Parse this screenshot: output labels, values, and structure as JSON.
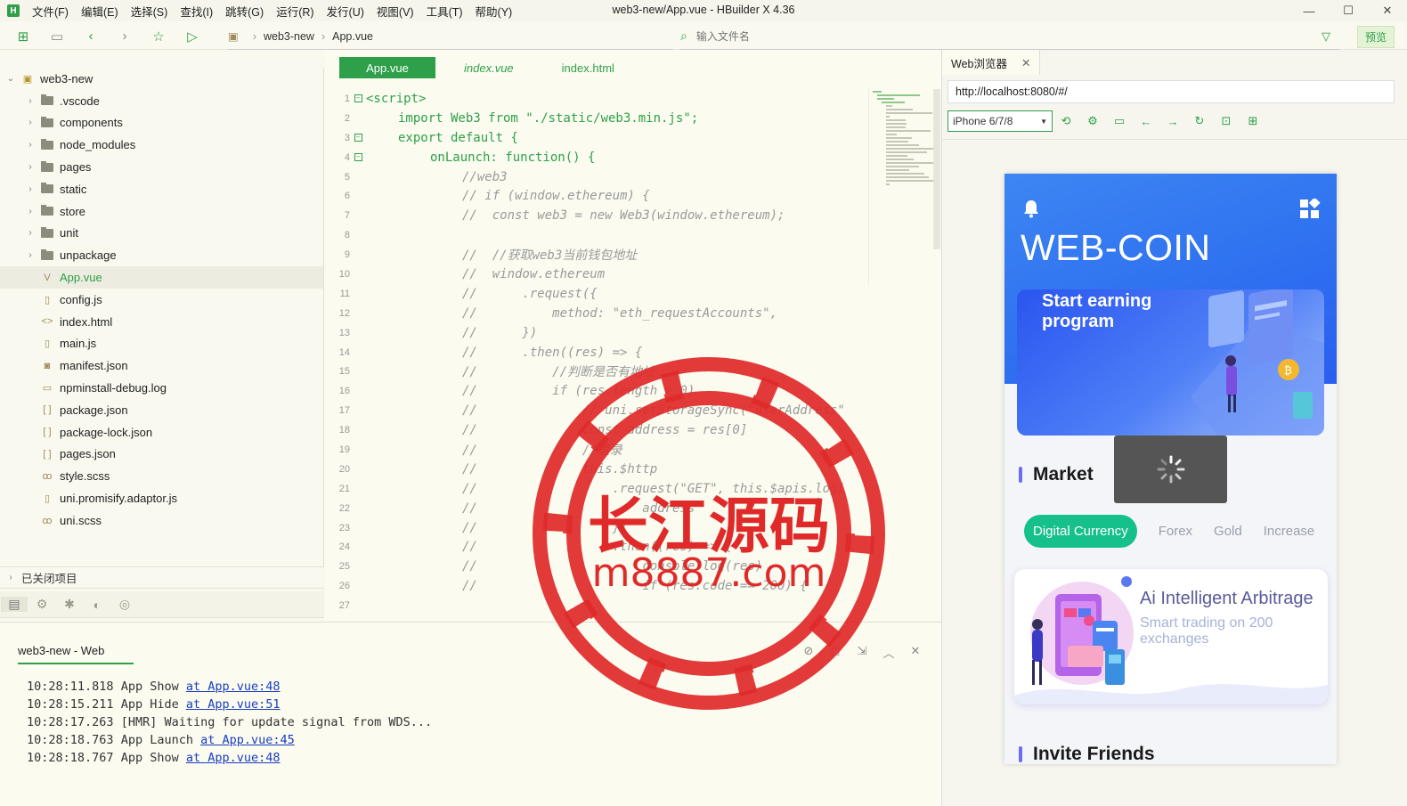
{
  "window": {
    "title": "web3-new/App.vue - HBuilder X 4.36",
    "menu": [
      "文件(F)",
      "编辑(E)",
      "选择(S)",
      "查找(I)",
      "跳转(G)",
      "运行(R)",
      "发行(U)",
      "视图(V)",
      "工具(T)",
      "帮助(Y)"
    ],
    "controls": [
      "—",
      "☐",
      "✕"
    ]
  },
  "toolbar": {
    "breadcrumb": [
      "web3-new",
      "App.vue"
    ],
    "search_placeholder": "输入文件名",
    "preview_label": "预览"
  },
  "sidebar": {
    "project": "web3-new",
    "items": [
      {
        "label": ".vscode",
        "kind": "folder"
      },
      {
        "label": "components",
        "kind": "folder"
      },
      {
        "label": "node_modules",
        "kind": "folder"
      },
      {
        "label": "pages",
        "kind": "folder"
      },
      {
        "label": "static",
        "kind": "folder"
      },
      {
        "label": "store",
        "kind": "folder"
      },
      {
        "label": "unit",
        "kind": "folder"
      },
      {
        "label": "unpackage",
        "kind": "folder"
      },
      {
        "label": "App.vue",
        "kind": "vue",
        "selected": true
      },
      {
        "label": "config.js",
        "kind": "js"
      },
      {
        "label": "index.html",
        "kind": "html"
      },
      {
        "label": "main.js",
        "kind": "js"
      },
      {
        "label": "manifest.json",
        "kind": "manifest"
      },
      {
        "label": "npminstall-debug.log",
        "kind": "log"
      },
      {
        "label": "package.json",
        "kind": "json"
      },
      {
        "label": "package-lock.json",
        "kind": "json"
      },
      {
        "label": "pages.json",
        "kind": "json"
      },
      {
        "label": "style.scss",
        "kind": "scss"
      },
      {
        "label": "uni.promisify.adaptor.js",
        "kind": "js"
      },
      {
        "label": "uni.scss",
        "kind": "scss"
      }
    ],
    "closed_projects": "已关闭项目"
  },
  "editor": {
    "tabs": [
      "App.vue",
      "index.vue",
      "index.html"
    ],
    "lines": [
      {
        "n": "1",
        "fold": "minus",
        "indent": 0,
        "text": "<script>",
        "comment": false
      },
      {
        "n": "2",
        "fold": "",
        "indent": 1,
        "text": "import Web3 from \"./static/web3.min.js\";",
        "comment": false
      },
      {
        "n": "3",
        "fold": "minus",
        "indent": 1,
        "text": "export default {",
        "comment": false
      },
      {
        "n": "4",
        "fold": "minus",
        "indent": 2,
        "text": "onLaunch: function() {",
        "comment": false
      },
      {
        "n": "5",
        "fold": "",
        "indent": 3,
        "text": "//web3",
        "comment": true
      },
      {
        "n": "6",
        "fold": "",
        "indent": 3,
        "text": "// if (window.ethereum) {",
        "comment": true
      },
      {
        "n": "7",
        "fold": "",
        "indent": 3,
        "text": "//  const web3 = new Web3(window.ethereum);",
        "comment": true
      },
      {
        "n": "8",
        "fold": "",
        "indent": 3,
        "text": "",
        "comment": true
      },
      {
        "n": "9",
        "fold": "",
        "indent": 3,
        "text": "//  //获取web3当前钱包地址",
        "comment": true
      },
      {
        "n": "10",
        "fold": "",
        "indent": 3,
        "text": "//  window.ethereum",
        "comment": true
      },
      {
        "n": "11",
        "fold": "",
        "indent": 3,
        "text": "//      .request({",
        "comment": true
      },
      {
        "n": "12",
        "fold": "",
        "indent": 3,
        "text": "//          method: \"eth_requestAccounts\",",
        "comment": true
      },
      {
        "n": "13",
        "fold": "",
        "indent": 3,
        "text": "//      })",
        "comment": true
      },
      {
        "n": "14",
        "fold": "",
        "indent": 3,
        "text": "//      .then((res) => {",
        "comment": true
      },
      {
        "n": "15",
        "fold": "",
        "indent": 3,
        "text": "//          //判断是否有地址",
        "comment": true
      },
      {
        "n": "16",
        "fold": "",
        "indent": 3,
        "text": "//          if (res.length > 0)",
        "comment": true
      },
      {
        "n": "17",
        "fold": "",
        "indent": 3,
        "text": "//              // uni.setStorageSync(\"userAddress\"",
        "comment": true
      },
      {
        "n": "18",
        "fold": "",
        "indent": 3,
        "text": "//              const address = res[0]",
        "comment": true
      },
      {
        "n": "19",
        "fold": "",
        "indent": 3,
        "text": "//              //登录",
        "comment": true
      },
      {
        "n": "20",
        "fold": "",
        "indent": 3,
        "text": "//              this.$http",
        "comment": true
      },
      {
        "n": "21",
        "fold": "",
        "indent": 3,
        "text": "//                  .request(\"GET\", this.$apis.logi",
        "comment": true
      },
      {
        "n": "22",
        "fold": "",
        "indent": 3,
        "text": "//                      address",
        "comment": true
      },
      {
        "n": "23",
        "fold": "",
        "indent": 3,
        "text": "//                  })",
        "comment": true
      },
      {
        "n": "24",
        "fold": "",
        "indent": 3,
        "text": "//                  .then((res) => {",
        "comment": true
      },
      {
        "n": "25",
        "fold": "",
        "indent": 3,
        "text": "//                      console.log(res)",
        "comment": true
      },
      {
        "n": "26",
        "fold": "",
        "indent": 3,
        "text": "//                      if (res.code == 200) {",
        "comment": true
      },
      {
        "n": "27",
        "fold": "",
        "indent": 3,
        "text": "",
        "comment": true
      }
    ]
  },
  "console": {
    "tab": "web3-new - Web",
    "lines": [
      {
        "time": "10:28:11.818",
        "msg": "App Show ",
        "link": "at App.vue:48"
      },
      {
        "time": "10:28:15.211",
        "msg": "App Hide ",
        "link": "at App.vue:51"
      },
      {
        "time": "10:28:17.263",
        "msg": "[HMR] Waiting for update signal from WDS...",
        "link": ""
      },
      {
        "time": "10:28:18.763",
        "msg": "App Launch ",
        "link": "at App.vue:45"
      },
      {
        "time": "10:28:18.767",
        "msg": "App Show ",
        "link": "at App.vue:48"
      }
    ]
  },
  "browser": {
    "tab_label": "Web浏览器",
    "url": "http://localhost:8080/#/",
    "device": "iPhone 6/7/8"
  },
  "phone": {
    "title": "WEB-COIN",
    "banner_text": "Start earning program",
    "market_title": "Market",
    "tabs": [
      "Digital Currency",
      "Forex",
      "Gold",
      "Increase"
    ],
    "card_title": "Ai Intelligent Arbitrage",
    "card_subtitle": "Smart trading on 200 exchanges",
    "invite_title": "Invite Friends",
    "colors": {
      "primary_blue": "#3d86f2",
      "active_pill": "#16c08a",
      "accent_bar": "#6a6ff0"
    }
  },
  "watermark": {
    "text_cn": "长江源码",
    "text_url": "m8887.com",
    "color": "#e02a2a"
  }
}
